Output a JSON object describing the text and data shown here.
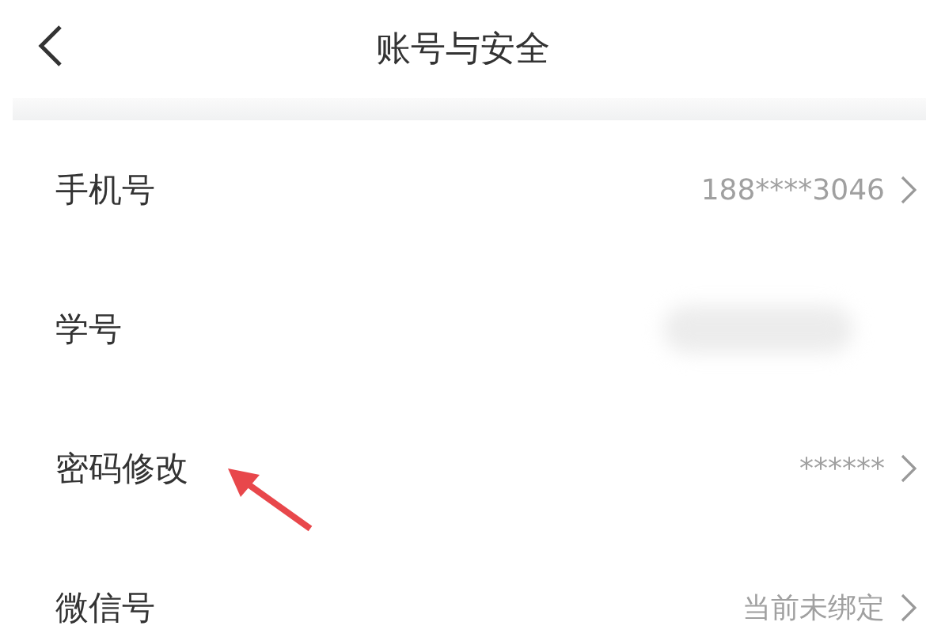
{
  "header": {
    "title": "账号与安全"
  },
  "rows": [
    {
      "label": "手机号",
      "kind": "text",
      "value": "188****3046",
      "chevron": true,
      "pointed": false
    },
    {
      "label": "学号",
      "kind": "blurred",
      "chevron": false,
      "pointed": false
    },
    {
      "label": "密码修改",
      "kind": "text",
      "value": "******",
      "chevron": true,
      "pointed": true
    },
    {
      "label": "微信号",
      "kind": "text",
      "value": "当前未绑定",
      "chevron": true,
      "pointed": false
    }
  ]
}
